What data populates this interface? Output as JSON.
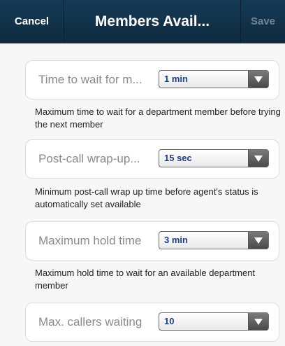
{
  "navbar": {
    "cancel_label": "Cancel",
    "title": "Members Avail...",
    "save_label": "Save"
  },
  "settings": [
    {
      "label": "Time to wait for m...",
      "value": "1 min",
      "description": "Maximum time to wait for a department member before trying the next member"
    },
    {
      "label": "Post-call wrap-up...",
      "value": "15 sec",
      "description": "Minimum post-call wrap up time before agent's status is automatically set available"
    },
    {
      "label": "Maximum hold time",
      "value": "3 min",
      "description": "Maximum hold time to wait for an available department member"
    },
    {
      "label": "Max. callers waiting",
      "value": "10"
    }
  ],
  "colors": {
    "navbar": "#153a56",
    "select_value": "#1c3f8c",
    "disabled_save": "#6f8596"
  }
}
